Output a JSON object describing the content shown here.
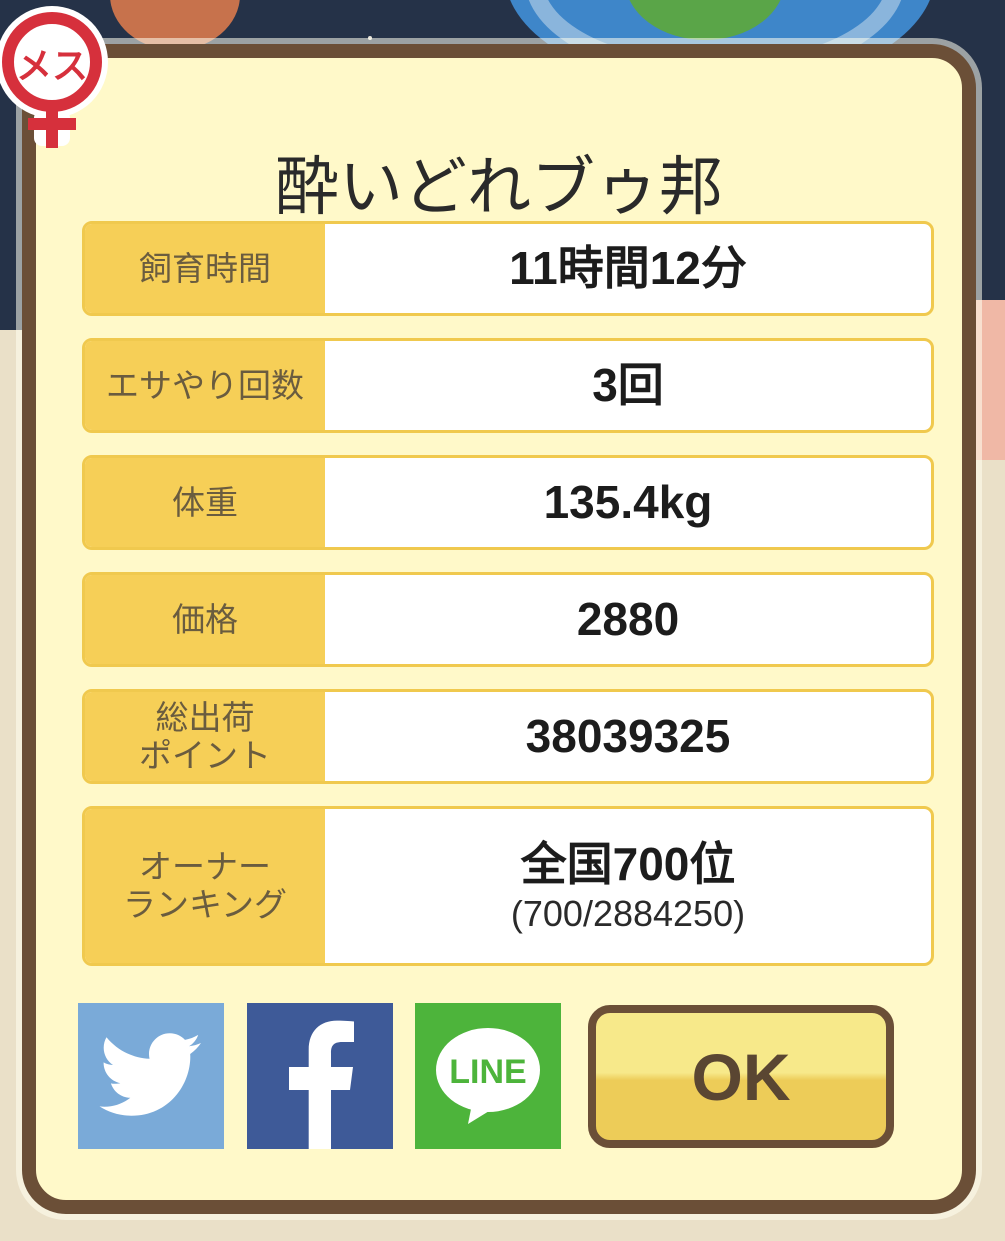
{
  "header": {
    "title": "酔いどれブゥ邦",
    "gender_badge_label": "メス"
  },
  "stats": [
    {
      "label": "飼育時間",
      "value": "11時間12分"
    },
    {
      "label": "エサやり回数",
      "value": "3回"
    },
    {
      "label": "体重",
      "value": "135.4kg"
    },
    {
      "label": "価格",
      "value": "2880"
    },
    {
      "label": "総出荷\nポイント",
      "value": "38039325"
    },
    {
      "label": "オーナー\nランキング",
      "value": "全国700位",
      "sub": "(700/2884250)"
    }
  ],
  "share": {
    "twitter_icon": "twitter-bird-icon",
    "facebook_label": "f",
    "line_label": "LINE"
  },
  "actions": {
    "ok_label": "OK"
  },
  "colors": {
    "panel_bg": "#fff9c9",
    "frame": "#6b4f37",
    "label_bg": "#f6cf57",
    "badge_red": "#d6303c",
    "twitter": "#7aaad8",
    "facebook": "#3e5a98",
    "line": "#4db43b"
  }
}
